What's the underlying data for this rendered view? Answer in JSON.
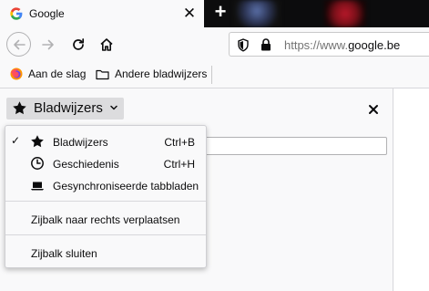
{
  "tab": {
    "title": "Google",
    "close": "✕"
  },
  "newtab": "+",
  "navbar": {
    "url_scheme": "https://www.",
    "url_host": "google.be"
  },
  "bookmarks_bar": {
    "items": [
      {
        "label": "Aan de slag",
        "icon": "firefox-icon"
      },
      {
        "label": "Andere bladwijzers",
        "icon": "folder-icon"
      }
    ]
  },
  "sidebar": {
    "switcher_label": "Bladwijzers",
    "close": "✕"
  },
  "menu": {
    "items": [
      {
        "label": "Bladwijzers",
        "shortcut": "Ctrl+B",
        "checked": "✓",
        "icon": "star-icon"
      },
      {
        "label": "Geschiedenis",
        "shortcut": "Ctrl+H",
        "icon": "history-icon"
      },
      {
        "label": "Gesynchroniseerde tabbladen",
        "icon": "laptop-icon"
      }
    ],
    "move_right": "Zijbalk naar rechts verplaatsen",
    "close_sidebar": "Zijbalk sluiten"
  },
  "colors": {
    "tabstrip": "#0c0c0d",
    "toolbar": "#f9f9fa",
    "accent_red": "#b8182a"
  }
}
